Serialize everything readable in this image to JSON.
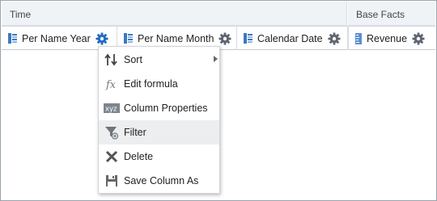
{
  "header": {
    "groups": [
      {
        "label": "Time"
      },
      {
        "label": "Base Facts"
      }
    ],
    "columns": [
      {
        "label": "Per Name Year",
        "icon": "dimension-column-icon"
      },
      {
        "label": "Per Name Month",
        "icon": "dimension-column-icon"
      },
      {
        "label": "Calendar Date",
        "icon": "dimension-column-icon"
      },
      {
        "label": "Revenue",
        "icon": "measure-column-icon"
      }
    ]
  },
  "context_menu": {
    "items": [
      {
        "label": "Sort",
        "icon": "sort-icon",
        "has_submenu": true
      },
      {
        "label": "Edit formula",
        "icon": "fx-icon",
        "has_submenu": false
      },
      {
        "label": "Column Properties",
        "icon": "xyz-icon",
        "has_submenu": false
      },
      {
        "label": "Filter",
        "icon": "filter-icon",
        "has_submenu": false,
        "highlighted": true
      },
      {
        "label": "Delete",
        "icon": "delete-icon",
        "has_submenu": false
      },
      {
        "label": "Save Column As",
        "icon": "save-icon",
        "has_submenu": false
      }
    ]
  },
  "colors": {
    "accent": "#2f6eb5",
    "gear_active": "#1f6bbf",
    "gear_inactive": "#5c6670",
    "header_bg": "#eff3f6",
    "menu_hover": "#eceeef"
  }
}
